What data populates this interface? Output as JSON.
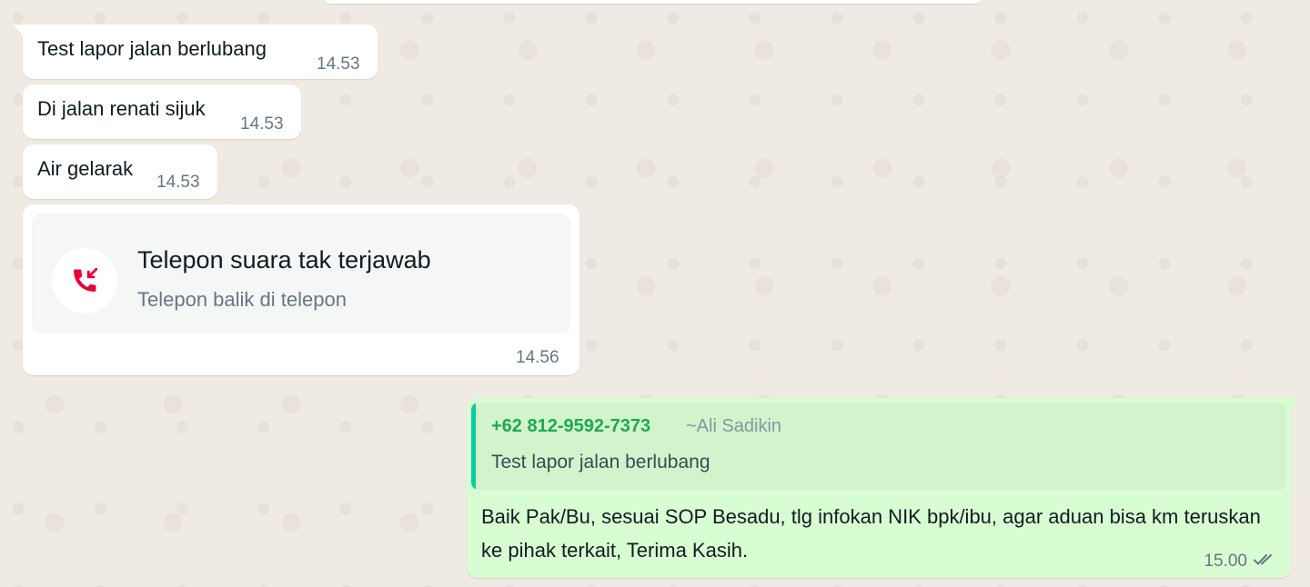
{
  "incoming": [
    {
      "text": "Test lapor jalan berlubang",
      "time": "14.53"
    },
    {
      "text": "Di jalan renati sijuk",
      "time": "14.53"
    },
    {
      "text": "Air gelarak",
      "time": "14.53"
    }
  ],
  "call": {
    "title": "Telepon suara tak terjawab",
    "subtitle": "Telepon balik di telepon",
    "time": "14.56",
    "icon": "missed-call-icon",
    "icon_color": "#ea0038"
  },
  "outgoing": {
    "quote": {
      "phone": "+62 812-9592-7373",
      "name": "~Ali Sadikin",
      "text": "Test lapor jalan berlubang"
    },
    "text": "Baik Pak/Bu, sesuai SOP Besadu, tlg infokan NIK bpk/ibu, agar aduan bisa km teruskan ke pihak terkait, Terima Kasih.",
    "time": "15.00",
    "status_icon": "double-check-icon"
  },
  "colors": {
    "incoming_bubble": "#ffffff",
    "outgoing_bubble": "#d9fdd3",
    "quote_accent": "#06cf9c",
    "quote_phone": "#1fa855",
    "wallpaper": "#efeae2"
  }
}
